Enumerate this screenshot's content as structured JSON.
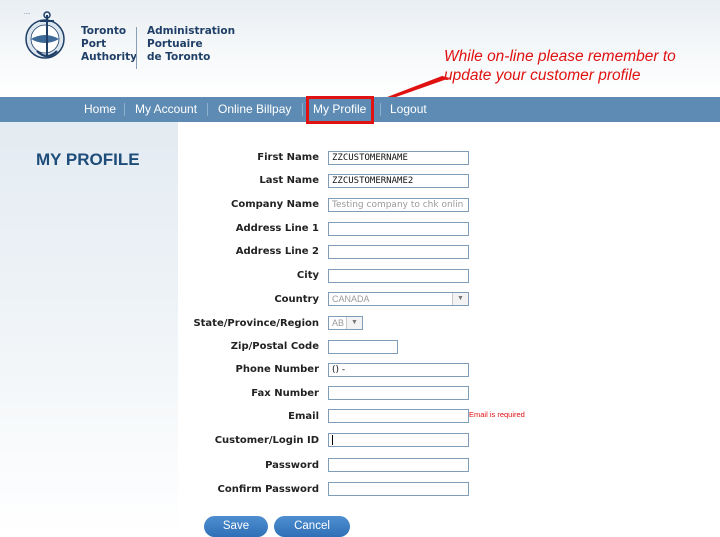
{
  "header": {
    "org_en": [
      "Toronto",
      "Port",
      "Authority"
    ],
    "org_fr": [
      "Administration",
      "Portuaire",
      "de Toronto"
    ],
    "annotation": [
      "While on-line please remember to",
      "update your customer profile"
    ]
  },
  "nav": {
    "items": [
      "Home",
      "My Account",
      "Online Billpay",
      "My Profile",
      "Logout"
    ],
    "active": "My Profile"
  },
  "page_title": "MY PROFILE",
  "form": {
    "first_name": {
      "label": "First Name",
      "value": "ZZCUSTOMERNAME"
    },
    "last_name": {
      "label": "Last Name",
      "value": "ZZCUSTOMERNAME2"
    },
    "company_name": {
      "label": "Company Name",
      "value": "Testing company to chk onlin"
    },
    "address1": {
      "label": "Address Line 1",
      "value": ""
    },
    "address2": {
      "label": "Address Line 2",
      "value": ""
    },
    "city": {
      "label": "City",
      "value": ""
    },
    "country": {
      "label": "Country",
      "value": "CANADA"
    },
    "state": {
      "label": "State/Province/Region",
      "value": "AB"
    },
    "zip": {
      "label": "Zip/Postal Code",
      "value": ""
    },
    "phone": {
      "label": "Phone Number",
      "value": "() -"
    },
    "fax": {
      "label": "Fax Number",
      "value": ""
    },
    "email": {
      "label": "Email",
      "value": "",
      "error": "Email is required"
    },
    "login_id": {
      "label": "Customer/Login ID",
      "value": ""
    },
    "password": {
      "label": "Password",
      "value": ""
    },
    "confirm_password": {
      "label": "Confirm Password",
      "value": ""
    }
  },
  "buttons": {
    "save": "Save",
    "cancel": "Cancel"
  },
  "colors": {
    "nav": "#5d8bb3",
    "title": "#1f4d7a",
    "annotation": "#e01111",
    "button": "#2e6fb6"
  }
}
